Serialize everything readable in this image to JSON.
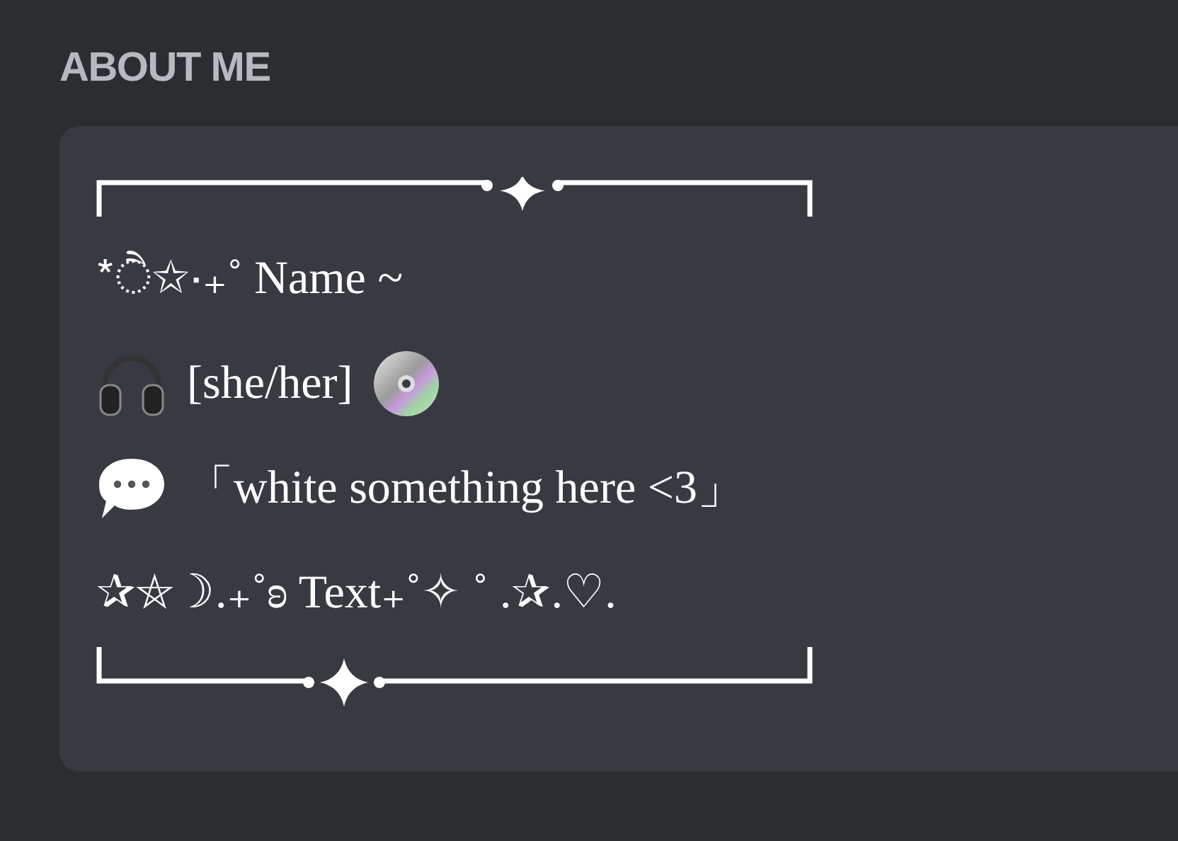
{
  "section": {
    "title": "ABOUT ME"
  },
  "bio": {
    "lines": [
      {
        "kind": "plain",
        "text": "*ੈ✩‧₊˚ Name ~"
      },
      {
        "kind": "pronouns",
        "text": "[she/her]"
      },
      {
        "kind": "quote",
        "text": "「white something here <3」"
      },
      {
        "kind": "plain",
        "text": "✰⛤☽.₊˚ʚ Text₊˚✧ ˚ .✰.♡."
      }
    ]
  }
}
